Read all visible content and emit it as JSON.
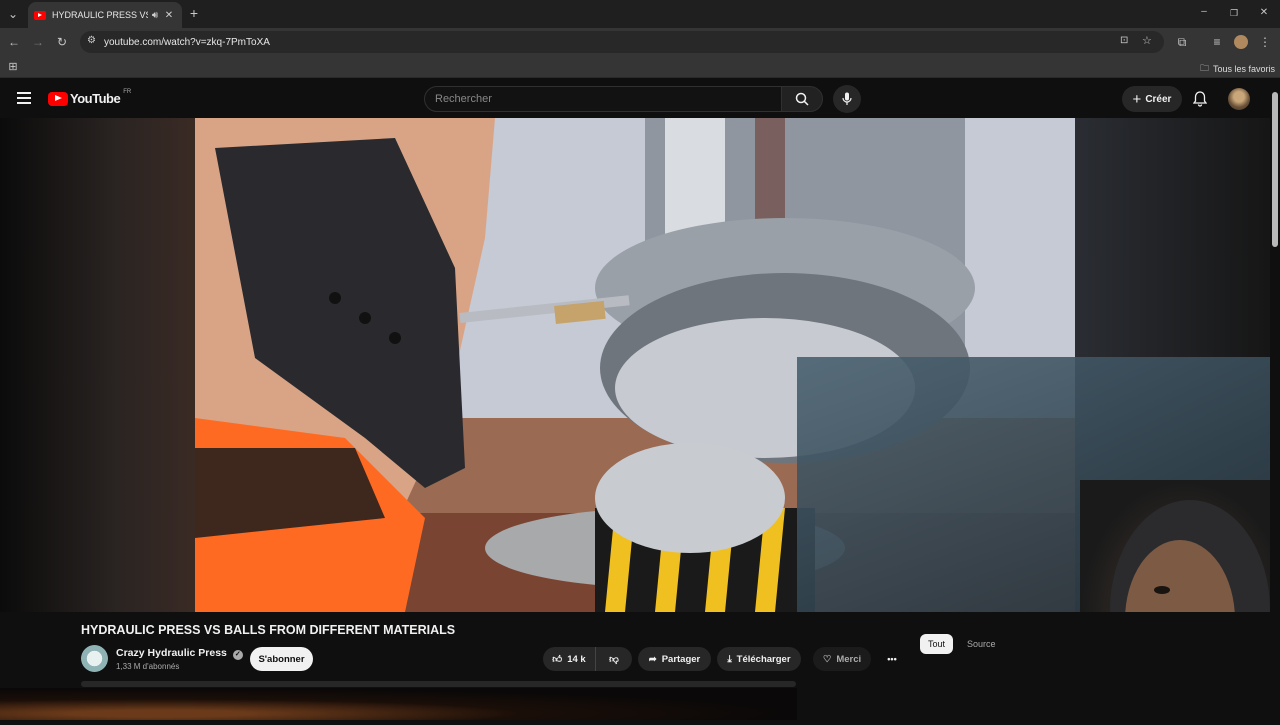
{
  "browser": {
    "tab_title": "HYDRAULIC PRESS VS BALLS",
    "url": "youtube.com/watch?v=zkq-7PmToXA",
    "bookmarks_folder": "Tous les favoris"
  },
  "youtube": {
    "logo_text": "YouTube",
    "region": "FR",
    "search_placeholder": "Rechercher",
    "create_label": "Créer"
  },
  "video": {
    "title": "HYDRAULIC PRESS VS BALLS FROM DIFFERENT MATERIALS",
    "channel_name": "Crazy Hydraulic Press",
    "subscribers": "1,33 M d'abonnés",
    "subscribe_label": "S'abonner",
    "likes": "14 k",
    "share_label": "Partager",
    "download_label": "Télécharger",
    "thanks_label": "Merci",
    "more_label": "•••"
  },
  "chips": [
    {
      "label": "Tout",
      "selected": true
    },
    {
      "label": "Source",
      "selected": false
    }
  ],
  "colors": {
    "brand_red": "#ff0000",
    "background": "#0f0f0f",
    "pill": "#272727"
  }
}
